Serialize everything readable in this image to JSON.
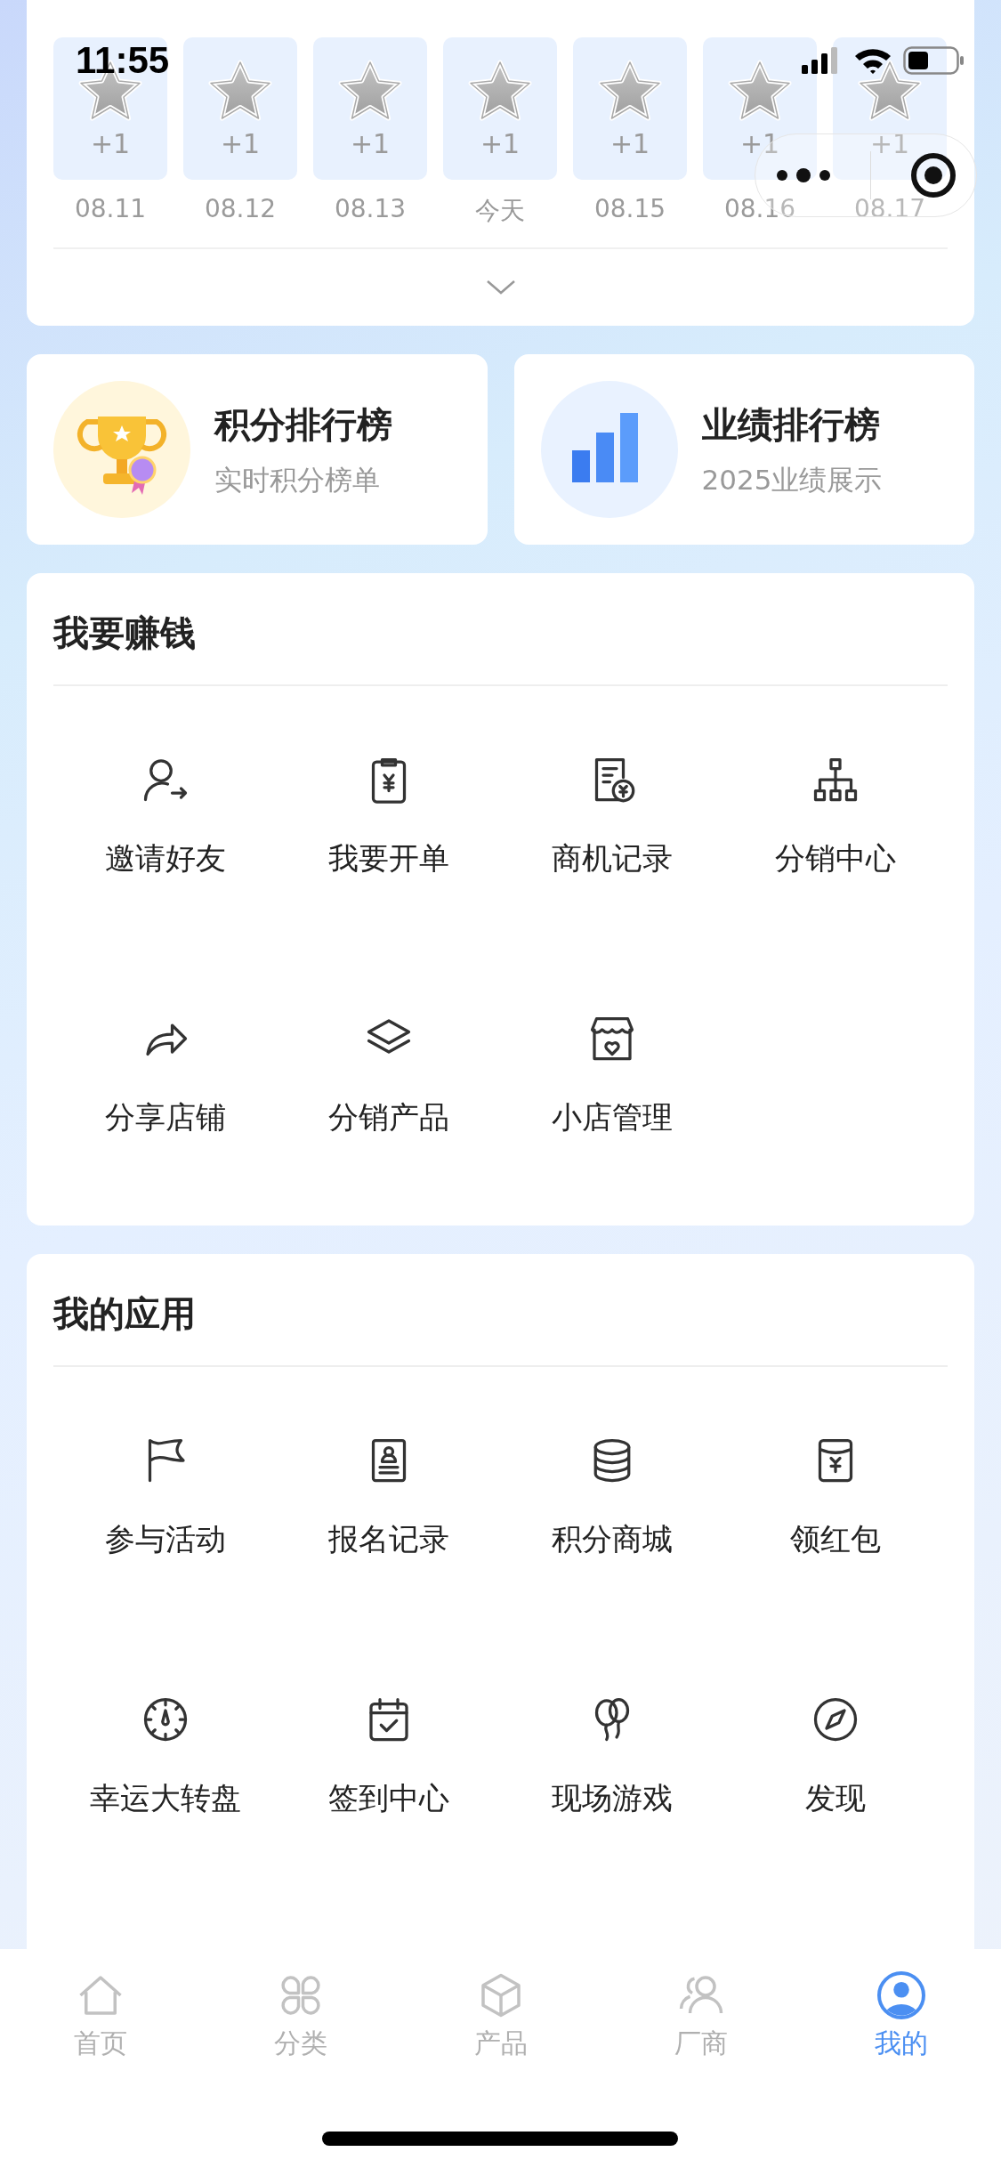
{
  "status_bar": {
    "time": "11:55"
  },
  "checkin": {
    "days": [
      {
        "points": "+1",
        "date": "08.11",
        "signed": false
      },
      {
        "points": "+1",
        "date": "08.12",
        "signed": false
      },
      {
        "points": "+1",
        "date": "08.13",
        "signed": false
      },
      {
        "points": "+1",
        "date": "今天",
        "signed": false
      },
      {
        "points": "+1",
        "date": "08.15",
        "signed": false
      },
      {
        "points": "+1",
        "date": "08.16",
        "signed": false
      },
      {
        "points": "+1",
        "date": "08.17",
        "signed": false
      }
    ]
  },
  "rankings": [
    {
      "title": "积分排行榜",
      "subtitle": "实时积分榜单"
    },
    {
      "title": "业绩排行榜",
      "subtitle": "2025业绩展示"
    }
  ],
  "sections": [
    {
      "title": "我要赚钱",
      "items": [
        "邀请好友",
        "我要开单",
        "商机记录",
        "分销中心",
        "分享店铺",
        "分销产品",
        "小店管理"
      ]
    },
    {
      "title": "我的应用",
      "items": [
        "参与活动",
        "报名记录",
        "积分商城",
        "领红包",
        "幸运大转盘",
        "签到中心",
        "现场游戏",
        "发现"
      ]
    }
  ],
  "tab_bar": [
    {
      "label": "首页",
      "selected": false
    },
    {
      "label": "分类",
      "selected": false
    },
    {
      "label": "产品",
      "selected": false
    },
    {
      "label": "厂商",
      "selected": false
    },
    {
      "label": "我的",
      "selected": true
    }
  ]
}
